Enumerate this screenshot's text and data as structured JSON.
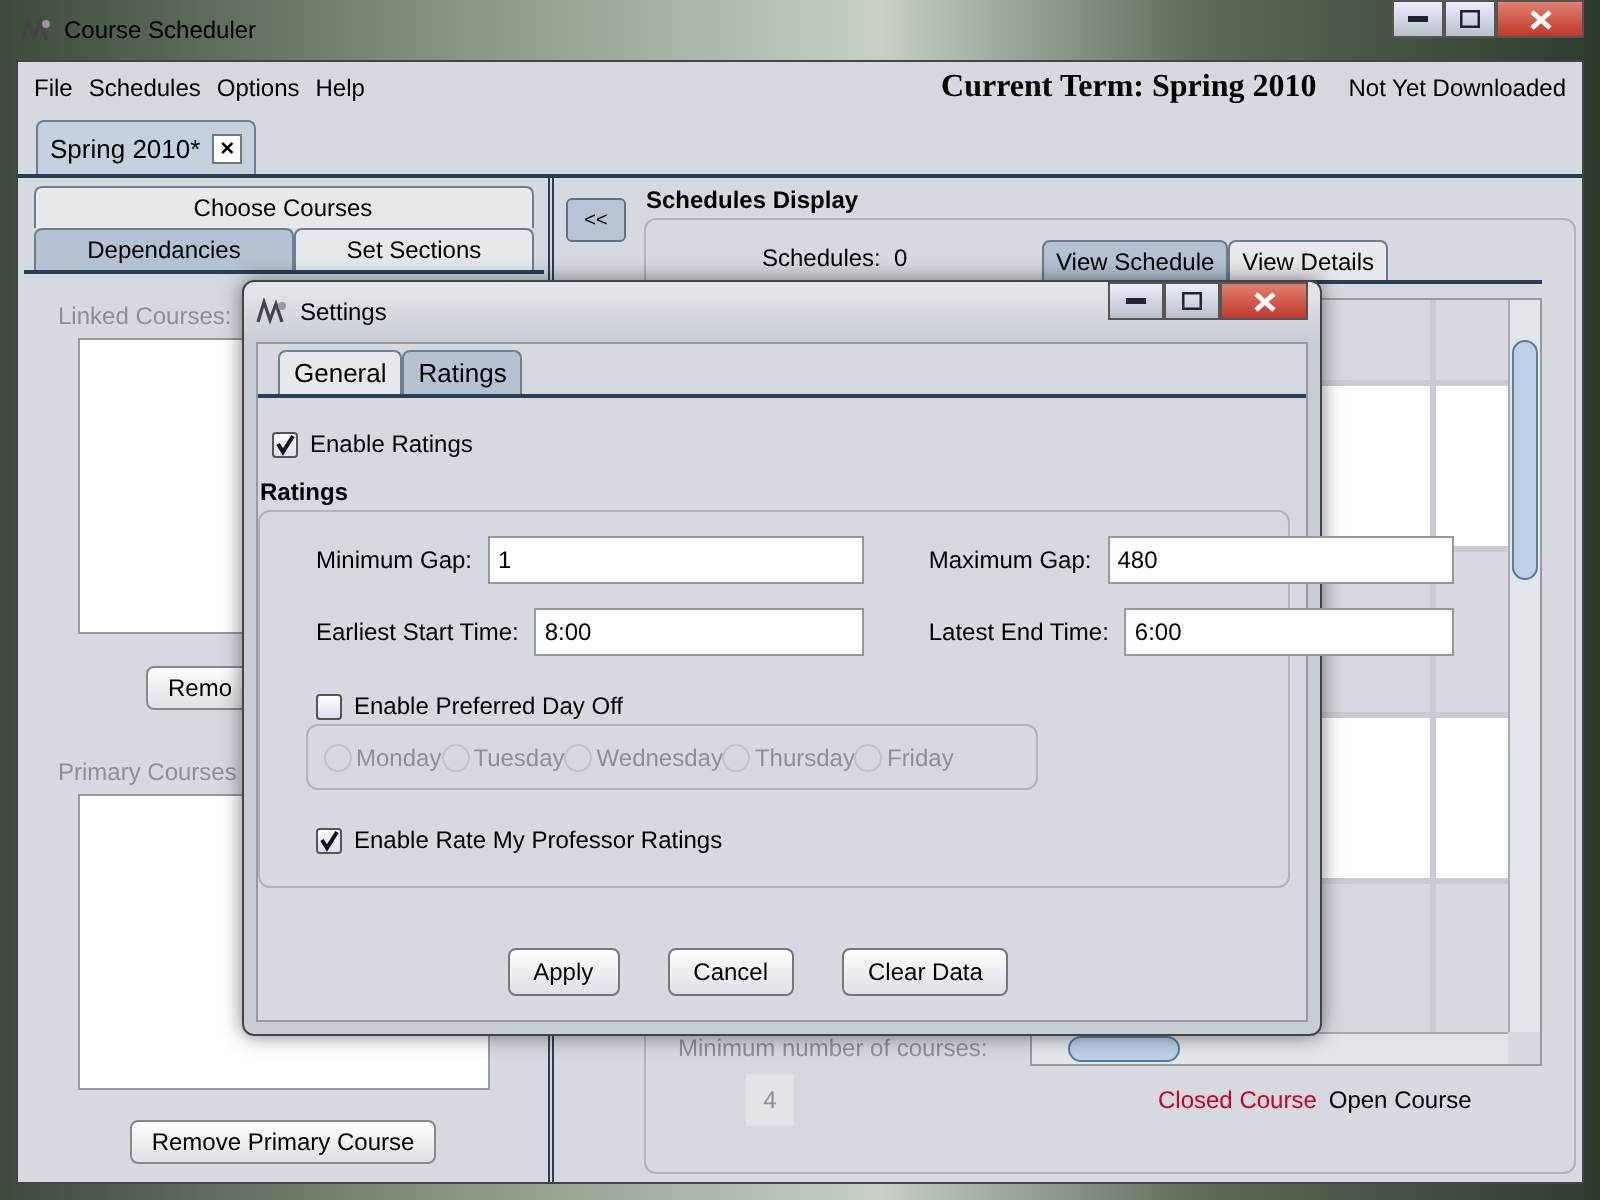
{
  "window": {
    "title": "Course Scheduler"
  },
  "menu": [
    "File",
    "Schedules",
    "Options",
    "Help"
  ],
  "term": {
    "label": "Current Term: Spring 2010",
    "status": "Not Yet Downloaded"
  },
  "document_tabs": [
    {
      "label": "Spring 2010*",
      "selected": true,
      "close": "×"
    }
  ],
  "course_tabs": [
    {
      "label": "Choose Courses",
      "selected": false
    },
    {
      "label": "Dependancies",
      "selected": true
    },
    {
      "label": "Set Sections",
      "selected": false
    }
  ],
  "linked_courses": {
    "label": "Linked Courses:",
    "button": "Remo"
  },
  "primary_courses": {
    "label": "Primary Courses",
    "button": "Remove Primary Course"
  },
  "collapse_button": "<<",
  "schedules_display": {
    "title": "Schedules Display",
    "count_label": "Schedules:",
    "count": "0",
    "tabs": [
      {
        "label": "View Schedule",
        "selected": true
      },
      {
        "label": "View Details",
        "selected": false
      }
    ],
    "min_courses_label": "Minimum number of courses:",
    "min_courses_value": "4",
    "legend": [
      {
        "label": "Closed Course",
        "color": "#cc0022"
      },
      {
        "label": "Open Course",
        "color": "#000000"
      }
    ]
  },
  "dialog": {
    "title": "Settings",
    "tabs": [
      {
        "label": "General",
        "selected": false
      },
      {
        "label": "Ratings",
        "selected": true
      }
    ],
    "enable_ratings": {
      "label": "Enable Ratings",
      "checked": true
    },
    "section": "Ratings",
    "fields": [
      {
        "label": "Minimum Gap:",
        "value": "1"
      },
      {
        "label": "Maximum Gap:",
        "value": "480"
      },
      {
        "label": "Earliest Start Time:",
        "value": "8:00"
      },
      {
        "label": "Latest End Time:",
        "value": "6:00"
      }
    ],
    "day_off": {
      "label": "Enable Preferred Day Off",
      "checked": false,
      "days": [
        {
          "label": "Monday",
          "selected": false
        },
        {
          "label": "Tuesday",
          "selected": false
        },
        {
          "label": "Wednesday",
          "selected": false
        },
        {
          "label": "Thursday",
          "selected": false
        },
        {
          "label": "Friday",
          "selected": false
        }
      ]
    },
    "rmp": {
      "label": "Enable Rate My Professor Ratings",
      "checked": true
    },
    "buttons": [
      "Apply",
      "Cancel",
      "Clear Data"
    ]
  }
}
